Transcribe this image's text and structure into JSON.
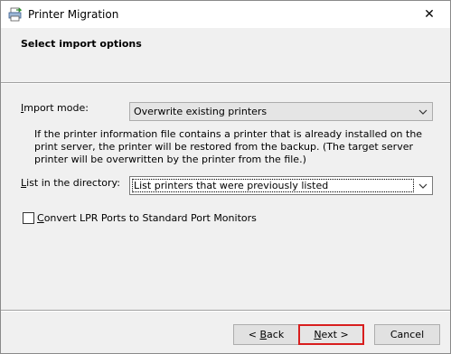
{
  "window": {
    "title": "Printer Migration",
    "close_label": "✕"
  },
  "header": {
    "title": "Select import options"
  },
  "import_mode": {
    "label_prefix": "",
    "label_accel": "I",
    "label_rest": "mport mode:",
    "selected": "Overwrite existing printers"
  },
  "description": "If the printer information file contains a printer that is already installed on the print server, the printer will be restored from the backup.  (The target server printer will be overwritten by the printer from the file.)",
  "directory": {
    "label_prefix": "",
    "label_accel": "L",
    "label_rest": "ist in the directory:",
    "selected": "List printers that were previously listed"
  },
  "convert_lpr": {
    "label_prefix": "",
    "label_accel": "C",
    "label_rest": "onvert LPR Ports to Standard Port Monitors",
    "checked": false
  },
  "buttons": {
    "back_prefix": "< ",
    "back_accel": "B",
    "back_rest": "ack",
    "next_prefix": "",
    "next_accel": "N",
    "next_rest": "ext >",
    "cancel_label": "Cancel"
  },
  "colors": {
    "default_button_border": "#d81e1e"
  }
}
